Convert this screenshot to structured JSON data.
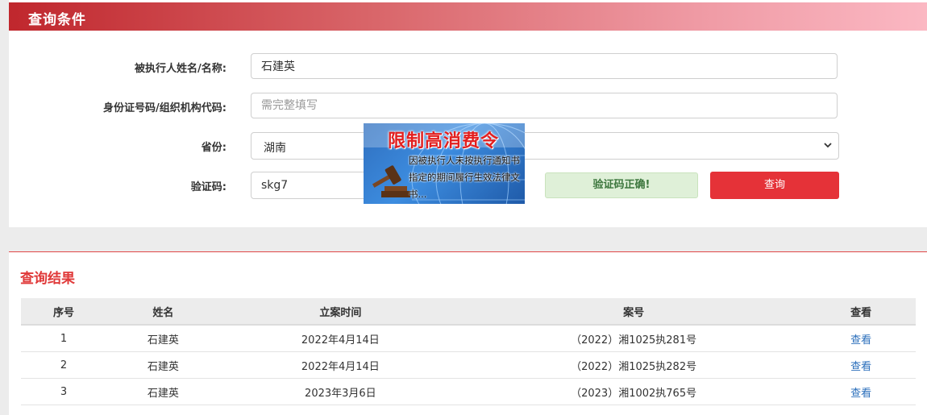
{
  "query_panel": {
    "title": "查询条件",
    "name_label": "被执行人姓名/名称:",
    "name_value": "石建英",
    "id_label": "身份证号码/组织机构代码:",
    "id_placeholder": "需完整填写",
    "province_label": "省份:",
    "province_value": "湖南",
    "captcha_label": "验证码:",
    "captcha_value": "skg7",
    "captcha_status": "验证码正确!",
    "query_button": "查询"
  },
  "ad": {
    "title": "限制高消费令",
    "text": "因被执行人未按执行通知书指定的期间履行生效法律文书..."
  },
  "results": {
    "title": "查询结果",
    "columns": [
      "序号",
      "姓名",
      "立案时间",
      "案号",
      "查看"
    ],
    "rows": [
      {
        "no": "1",
        "name": "石建英",
        "date": "2022年4月14日",
        "case": "（2022）湘1025执281号",
        "action": "查看"
      },
      {
        "no": "2",
        "name": "石建英",
        "date": "2022年4月14日",
        "case": "（2022）湘1025执282号",
        "action": "查看"
      },
      {
        "no": "3",
        "name": "石建英",
        "date": "2023年3月6日",
        "case": "（2023）湘1002执765号",
        "action": "查看"
      }
    ]
  },
  "colors": {
    "accent_red": "#e53238",
    "header_gradient_start": "#c0272d",
    "header_gradient_end": "#fbb8c3",
    "success_bg": "#dff0d8",
    "link_blue": "#2a6ebb"
  }
}
